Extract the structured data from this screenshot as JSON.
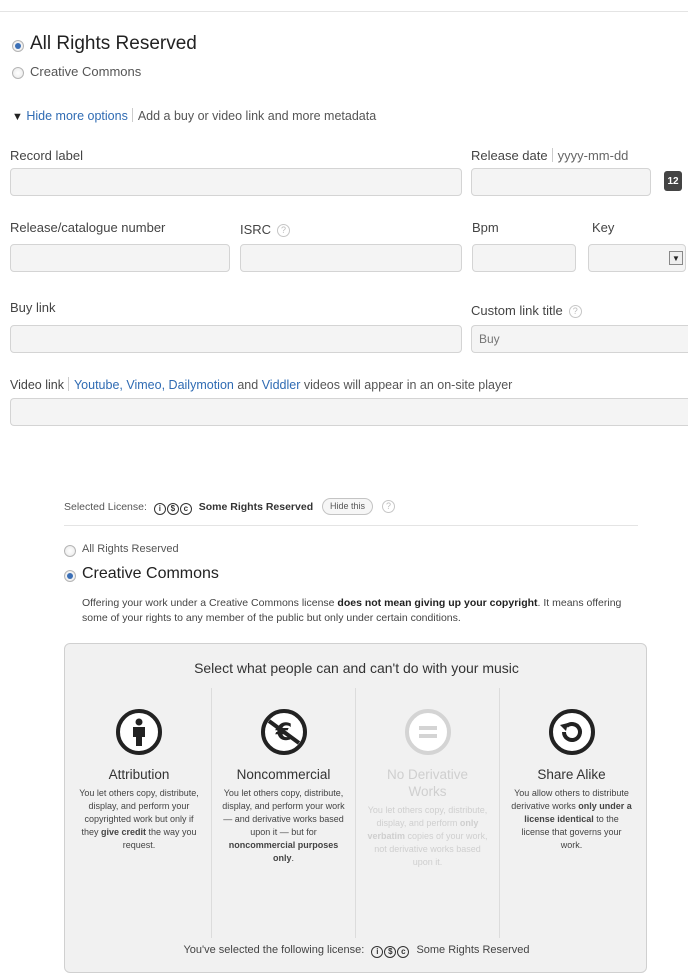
{
  "license_top": {
    "all_rights": "All Rights Reserved",
    "creative_commons": "Creative Commons",
    "hide_more_options": "Hide more options",
    "add_buy_link": "Add a buy or video link and more metadata"
  },
  "metadata": {
    "record_label": "Record label",
    "release_date": "Release date",
    "release_date_format": "yyyy-mm-dd",
    "calendar_day": "12",
    "release_catalogue": "Release/catalogue number",
    "isrc": "ISRC",
    "bpm": "Bpm",
    "key": "Key",
    "buy_link": "Buy link",
    "custom_link_title": "Custom link title",
    "custom_link_placeholder": "Buy",
    "help_glyph": "?",
    "video_link": "Video link",
    "video_youtube": "Youtube",
    "video_vimeo": "Vimeo",
    "video_dailymotion": "Dailymotion",
    "video_and": "and",
    "video_viddler": "Viddler",
    "video_suffix": "videos will appear in an on-site player"
  },
  "selected_license": {
    "label": "Selected License:",
    "value": "Some Rights Reserved",
    "hide_button": "Hide this"
  },
  "license_bottom": {
    "all_rights": "All Rights Reserved",
    "creative_commons": "Creative Commons",
    "intro_1": "Offering your work under a Creative Commons license ",
    "intro_bold": "does not mean giving up your copyright",
    "intro_2": ". It means offering some of your rights to any member of the public but only under certain conditions."
  },
  "cc_panel": {
    "heading": "Select what people can and can't do with your music",
    "attribution_title": "Attribution",
    "attribution_desc_1": "You let others copy, distribute, display, and perform your copyrighted work but only if they ",
    "attribution_desc_bold": "give credit",
    "attribution_desc_2": " the way you request.",
    "noncommercial_title": "Noncommercial",
    "noncommercial_desc_1": "You let others copy, distribute, display, and perform your work — and derivative works based upon it — but for ",
    "noncommercial_desc_bold": "noncommercial purposes only",
    "noncommercial_desc_2": ".",
    "noderiv_title": "No Derivative Works",
    "noderiv_desc_1": "You let others copy, distribute, display, and perform ",
    "noderiv_desc_bold": "only verbatim",
    "noderiv_desc_2": " copies of your work, not derivative works based upon it.",
    "sharealike_title": "Share Alike",
    "sharealike_desc_1": "You allow others to distribute derivative works ",
    "sharealike_desc_bold": "only under a license identical",
    "sharealike_desc_2": " to the license that governs your work.",
    "footer_label": "You've selected the following license:",
    "footer_value": "Some Rights Reserved"
  },
  "colors": {
    "link": "#2f6bb3",
    "radio_selected": "#3b6fb6"
  }
}
